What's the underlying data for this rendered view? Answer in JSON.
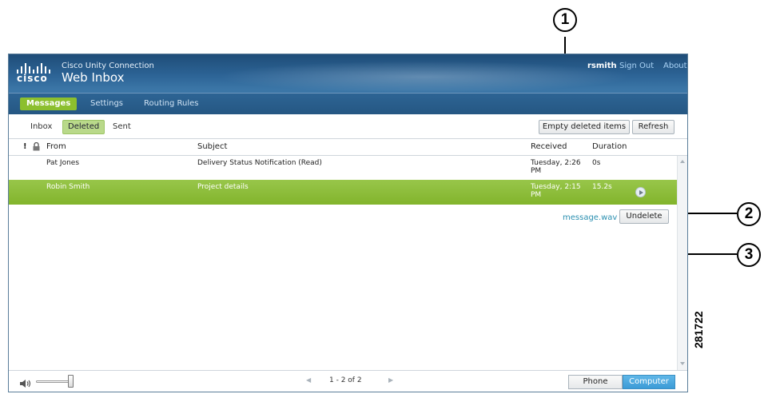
{
  "brand": {
    "company": "cisco",
    "product": "Cisco Unity Connection",
    "app_name": "Web Inbox"
  },
  "user": {
    "name": "rsmith",
    "sign_out": "Sign Out",
    "about": "About"
  },
  "tabs": [
    "Messages",
    "Settings",
    "Routing Rules"
  ],
  "folders": [
    "Inbox",
    "Deleted",
    "Sent"
  ],
  "toolbar": {
    "empty_deleted": "Empty deleted items",
    "refresh": "Refresh"
  },
  "columns": {
    "urgent": "!",
    "from": "From",
    "subject": "Subject",
    "received": "Received",
    "duration": "Duration"
  },
  "messages": [
    {
      "from": "Pat Jones",
      "subject": "Delivery Status Notification (Read)",
      "received_line1": "Tuesday, 2:26",
      "received_line2": "PM",
      "duration": "0s"
    },
    {
      "from": "Robin Smith",
      "subject": "Project details",
      "received_line1": "Tuesday, 2:15",
      "received_line2": "PM",
      "duration": "15.2s"
    }
  ],
  "detail": {
    "attachment": "message.wav",
    "undelete": "Undelete"
  },
  "pager": {
    "text": "1 - 2 of 2"
  },
  "playback": {
    "phone": "Phone",
    "computer": "Computer"
  },
  "callouts": [
    "1",
    "2",
    "3"
  ],
  "figure_id": "281722",
  "colors": {
    "header": "#2c6395",
    "accent_green": "#8cbf2e",
    "selected_row": "#8fbf3d",
    "active_blue": "#3c9bd6",
    "link_teal": "#2a8fb0"
  }
}
